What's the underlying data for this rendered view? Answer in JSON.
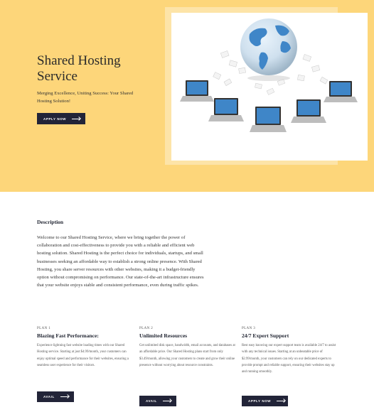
{
  "hero": {
    "title": "Shared Hosting Service",
    "subtitle": "Merging Excellence, Uniting Success: Your Shared Hosting Solution!",
    "button_label": "APPLY NOW",
    "image_icon": "globe-network-laptops-icon"
  },
  "description": {
    "heading": "Description",
    "body": "Welcome to our Shared Hosting Service, where we bring together the power of collaboration and cost-effectiveness to provide you with a reliable and efficient web hosting solution. Shared Hosting is the perfect choice for individuals, startups, and small businesses seeking an affordable way to establish a strong online presence. With Shared Hosting, you share server resources with other websites, making it a budget-friendly option without compromising on performance. Our state-of-the-art infrastructure ensures that your website enjoys stable and consistent performance, even during traffic spikes."
  },
  "plans": [
    {
      "label": "PLAN 1",
      "title": "Blazing Fast Performance:",
      "text": "Experience lightning fast website loading times with our Shared Hosting service. Starting at just $4.99/month, your customers can enjoy optimal speed and performance for their websites, ensuring a seamless user experience for their visitors.",
      "button_label": "AVAIL"
    },
    {
      "label": "PLAN 2",
      "title": "Unlimited Resources",
      "text": "Get unlimited disk space, bandwidth, email accounts, and databases at an affordable price. Our Shared Hosting plans start from only $3.49/month, allowing your customers to create and grow their online presence without worrying about resource constraints.",
      "button_label": "AVAIL"
    },
    {
      "label": "PLAN 3",
      "title": "24/7 Expert Support",
      "text": "Rest easy knowing our expert support team is available 24/7 to assist with any technical issues. Starting at an unbeatable price of $2.99/month, your customers can rely on our dedicated experts to provide prompt and reliable support, ensuring their websites stay up and running smoothly.",
      "button_label": "APPLY NOW"
    }
  ],
  "colors": {
    "hero_bg": "#fdd67a",
    "frame": "#fde4a8",
    "button_bg": "#222438",
    "globe_blue": "#3f86c8"
  }
}
